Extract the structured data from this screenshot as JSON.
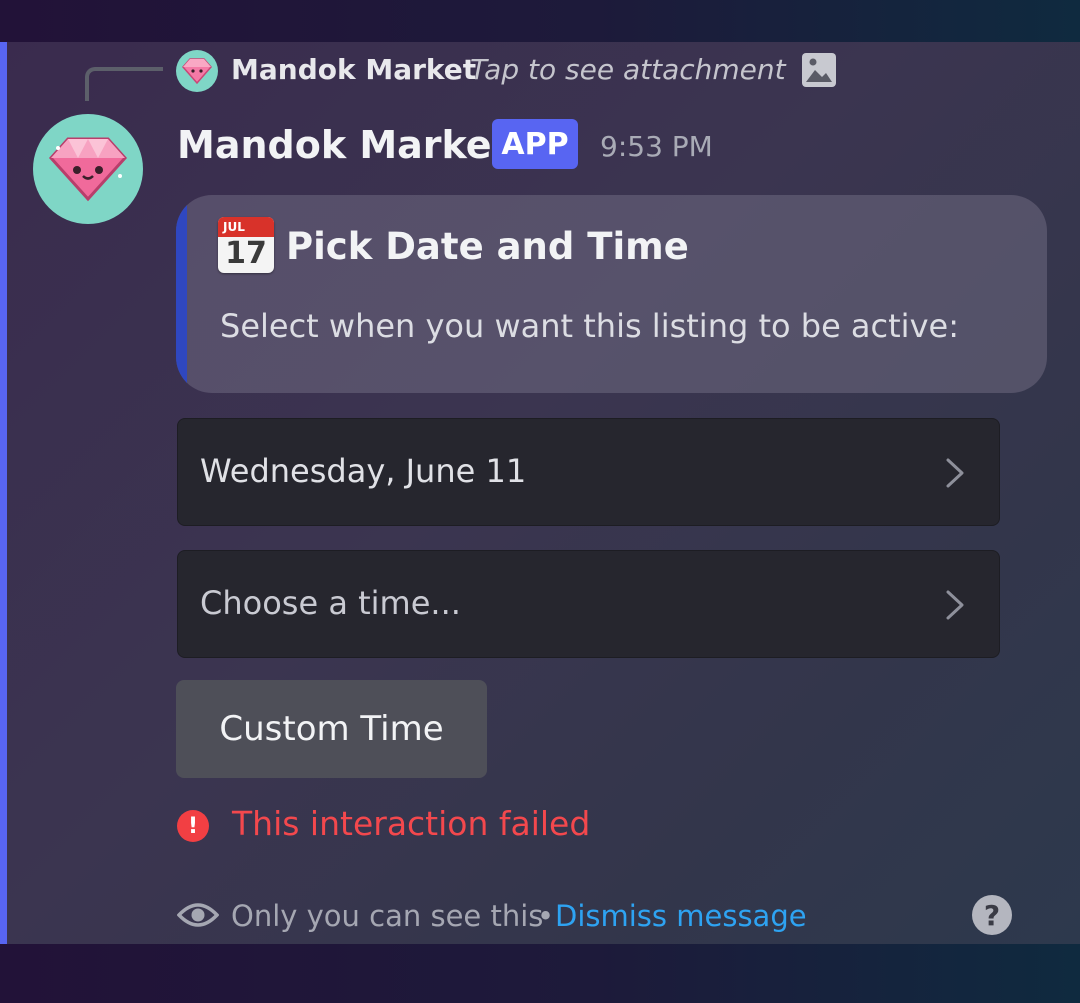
{
  "reply": {
    "author": "Mandok Market",
    "preview": "Tap to see attachment",
    "attachment_icon": "image-icon"
  },
  "message": {
    "author": "Mandok Market",
    "badge": "APP",
    "timestamp": "9:53 PM",
    "avatar_icon": "pink-diamond-icon"
  },
  "embed": {
    "icon": "calendar-icon",
    "icon_month": "JUL",
    "icon_day": "17",
    "title": "Pick Date and Time",
    "description": "Select when you want this listing to be active:",
    "accent_color": "#2f47c0"
  },
  "components": {
    "date_select": {
      "value": "Wednesday, June 11"
    },
    "time_select": {
      "placeholder": "Choose a time..."
    },
    "custom_button": {
      "label": "Custom Time"
    }
  },
  "error": {
    "text": "This interaction failed",
    "color": "#f3484d"
  },
  "footer": {
    "visibility_text": "Only you can see this",
    "separator": "•",
    "dismiss_label": "Dismiss message",
    "dismiss_color": "#2ea3f2"
  },
  "colors": {
    "brand": "#5865f2",
    "select_bg": "#26262e",
    "button_bg": "#4e4f58"
  }
}
